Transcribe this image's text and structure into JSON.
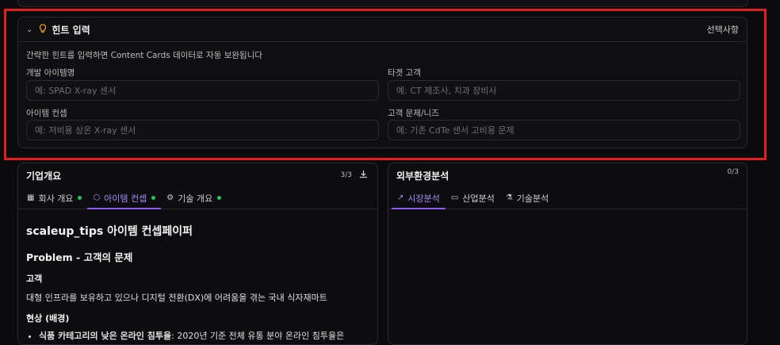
{
  "hint": {
    "title": "힌트 입력",
    "optional_label": "선택사항",
    "description": "간략한 힌트를 입력하면 Content Cards 데이터로 자동 보완됩니다",
    "fields": [
      {
        "label": "개발 아이템명",
        "placeholder": "예: SPAD X-ray 센서",
        "value": ""
      },
      {
        "label": "타겟 고객",
        "placeholder": "예: CT 제조사, 치과 장비사",
        "value": ""
      },
      {
        "label": "아이템 컨셉",
        "placeholder": "예: 저비용 상온 X-ray 센서",
        "value": ""
      },
      {
        "label": "고객 문제/니즈",
        "placeholder": "예: 기존 CdTe 센서 고비용 문제",
        "value": ""
      }
    ]
  },
  "left_panel": {
    "title": "기업개요",
    "count": "3/3",
    "tabs": [
      {
        "label": "회사 개요",
        "icon": "building-icon",
        "status": "complete"
      },
      {
        "label": "아이템 컨셉",
        "icon": "box-icon",
        "status": "complete"
      },
      {
        "label": "기술 개요",
        "icon": "gear-icon",
        "status": "complete"
      }
    ],
    "active_tab": 1,
    "content": {
      "h1": "scaleup_tips 아이템 컨셉페이퍼",
      "h2": "Problem - 고객의 문제",
      "customer_heading": "고객",
      "customer_text": "대형 인프라를 보유하고 있으나 디지털 전환(DX)에 어려움을 겪는 국내 식자재마트",
      "situation_heading": "현상 (배경)",
      "bullet_bold": "식품 카테고리의 낮은 온라인 침투율",
      "bullet_text": ": 2020년 기준 전체 유통 분야 온라인 침투율은"
    }
  },
  "right_panel": {
    "title": "외부환경분석",
    "count": "0/3",
    "tabs": [
      {
        "label": "시장분석",
        "icon": "trend-icon"
      },
      {
        "label": "산업분석",
        "icon": "folder-icon"
      },
      {
        "label": "기술분석",
        "icon": "flask-icon"
      }
    ],
    "active_tab": 0
  },
  "colors": {
    "accent": "#8b5cf6",
    "status_green": "#22c55e",
    "highlight_red": "#e01e1e",
    "bulb": "#f59e0b"
  }
}
